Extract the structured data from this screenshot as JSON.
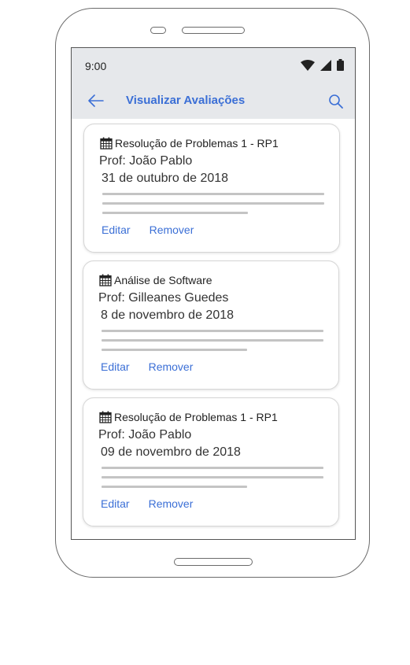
{
  "status_bar": {
    "time": "9:00",
    "icons": [
      "wifi-icon",
      "signal-icon",
      "battery-icon"
    ]
  },
  "app_bar": {
    "title": "Visualizar Avaliações",
    "back_icon": "arrow-left-icon",
    "search_icon": "search-icon"
  },
  "evaluations": [
    {
      "icon": "calendar-icon",
      "title": "Resolução de Problemas 1 - RP1",
      "professor": "Prof: João Pablo",
      "date": "31 de outubro de 2018",
      "edit_label": "Editar",
      "remove_label": "Remover"
    },
    {
      "icon": "calendar-icon",
      "title": "Análise de Software",
      "professor": "Prof: Gilleanes Guedes",
      "date": "8 de novembro de 2018",
      "edit_label": "Editar",
      "remove_label": "Remover"
    },
    {
      "icon": "calendar-icon",
      "title": "Resolução de Problemas 1 - RP1",
      "professor": "Prof: João Pablo",
      "date": "09 de novembro de 2018",
      "edit_label": "Editar",
      "remove_label": "Remover"
    }
  ],
  "colors": {
    "accent": "#3b6fd6",
    "app_bar_bg": "#e6e8eb",
    "placeholder_line": "#c4c4c4"
  }
}
